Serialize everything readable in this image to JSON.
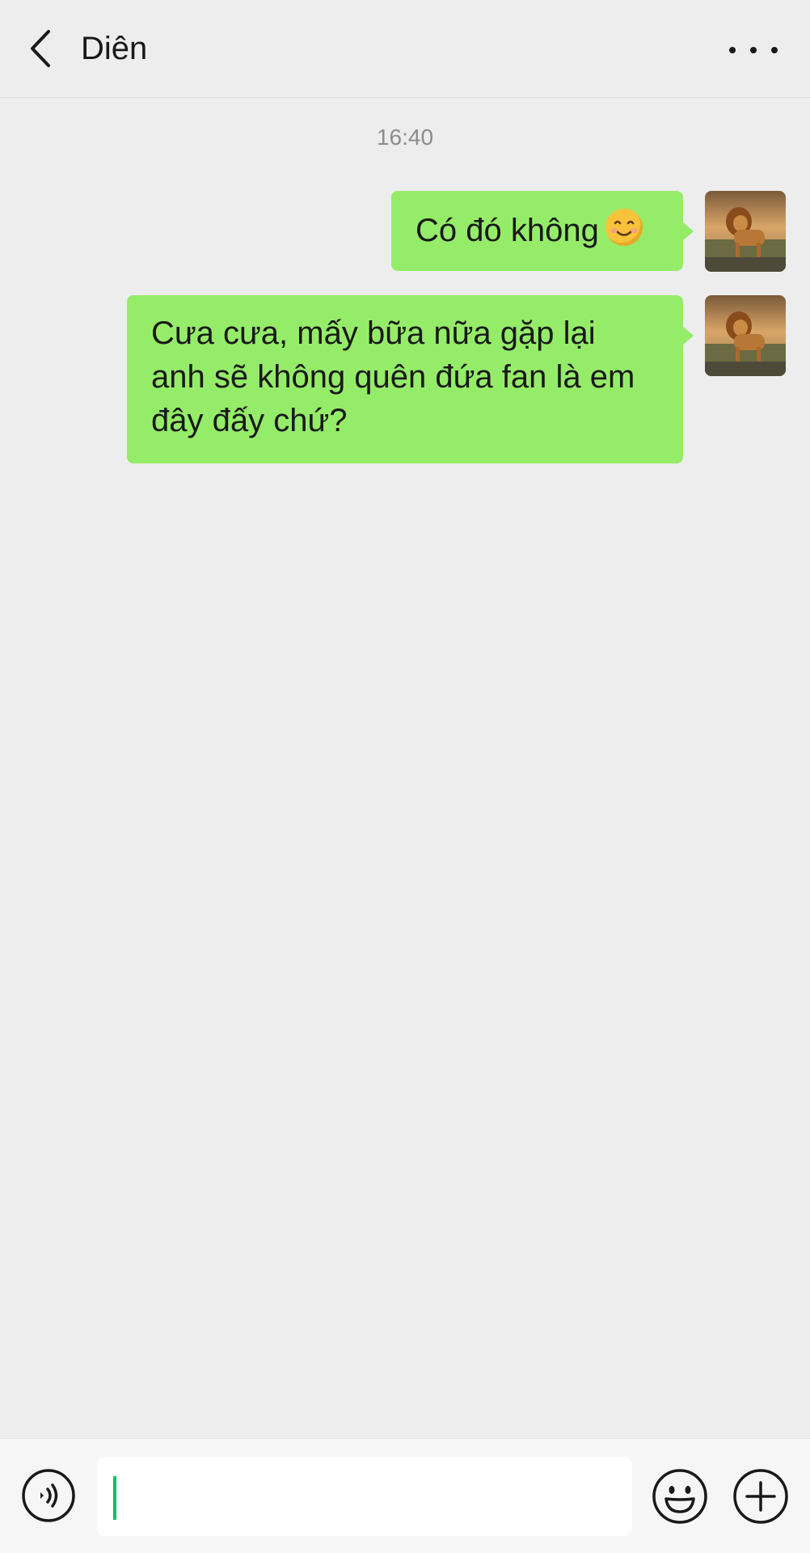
{
  "header": {
    "title": "Diên",
    "back_icon": "chevron-left-icon",
    "more_icon": "more-horizontal-icon"
  },
  "chat": {
    "timestamp": "16:40",
    "messages": [
      {
        "sender": "self",
        "text": "Có đó không",
        "emoji": "smiling-face-icon",
        "avatar": "lion-avatar"
      },
      {
        "sender": "self",
        "line1": "Cưa cưa, mấy bữa nữa gặp lại",
        "line2": "anh sẽ không quên đứa fan là em",
        "line3": "đây đấy chứ?",
        "avatar": "lion-avatar"
      }
    ],
    "bubble_color": "#95ec69",
    "background_color": "#ededed"
  },
  "input_bar": {
    "voice_icon": "voice-icon",
    "input_value": "",
    "emoji_icon": "emoji-icon",
    "plus_icon": "plus-icon",
    "caret_color": "#07c160"
  }
}
